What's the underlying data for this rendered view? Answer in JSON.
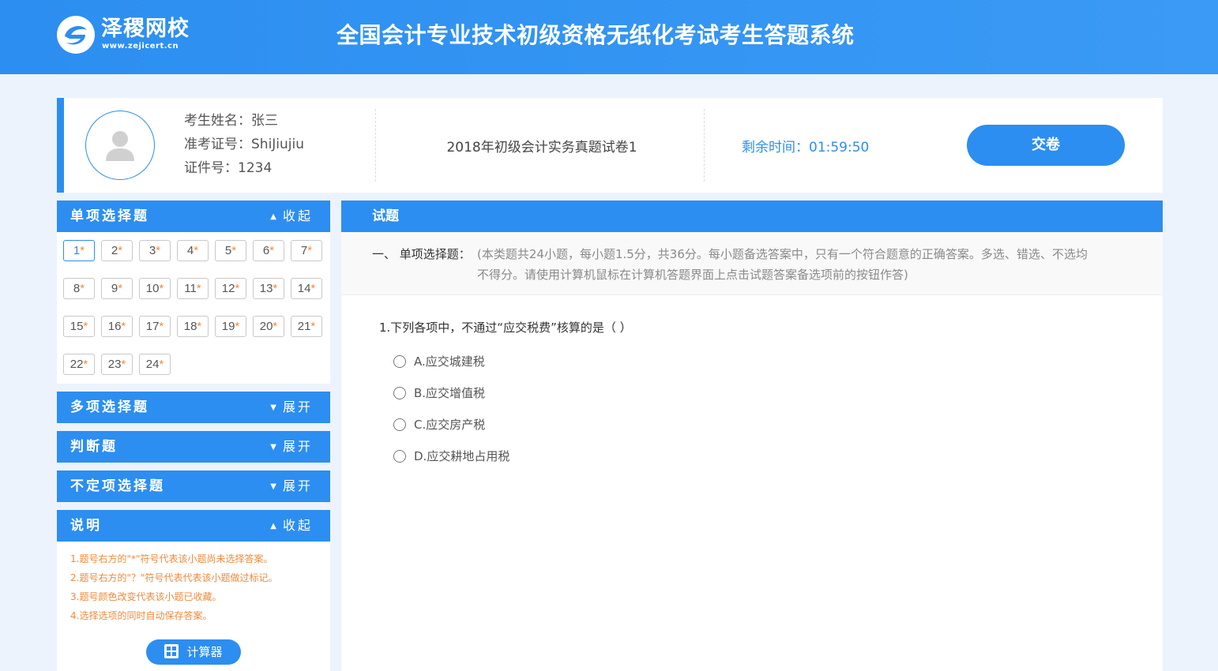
{
  "header": {
    "brand_name": "泽稷网校",
    "brand_url": "www.zejicert.cn",
    "title": "全国会计专业技术初级资格无纸化考试考生答题系统",
    "bg_color": "#2c8ef0"
  },
  "candidate": {
    "name_label": "考生姓名：",
    "name": "张三",
    "ticket_label": "准考证号：",
    "ticket": "ShiJiujiu",
    "id_label": "证件号：",
    "id": "1234"
  },
  "exam": {
    "paper_title": "2018年初级会计实务真题试卷1",
    "timer_label": "剩余时间：",
    "timer": "01:59:50",
    "submit_label": "交卷"
  },
  "sidebar": {
    "sections": [
      {
        "title": "单项选择题",
        "toggle": "收起",
        "arrow": "▲"
      },
      {
        "title": "多项选择题",
        "toggle": "展开",
        "arrow": "▼"
      },
      {
        "title": "判断题",
        "toggle": "展开",
        "arrow": "▼"
      },
      {
        "title": "不定项选择题",
        "toggle": "展开",
        "arrow": "▼"
      },
      {
        "title": "说明",
        "toggle": "收起",
        "arrow": "▲"
      }
    ],
    "questions": [
      "1",
      "2",
      "3",
      "4",
      "5",
      "6",
      "7",
      "8",
      "9",
      "10",
      "11",
      "12",
      "13",
      "14",
      "15",
      "16",
      "17",
      "18",
      "19",
      "20",
      "21",
      "22",
      "23",
      "24"
    ],
    "unanswered_mark": "*",
    "active_question": "1",
    "notes": [
      "1.题号右方的\"*\"符号代表该小题尚未选择答案。",
      "2.题号右方的\"？\"符号代表代表该小题做过标记。",
      "3.题号颜色改变代表该小题已收藏。",
      "4.选择选项的同时自动保存答案。"
    ],
    "calculator_label": "计算器"
  },
  "question_panel": {
    "header": "试题",
    "section_label": "一、 单项选择题：",
    "instructions_line1": "(本类题共24小题，每小题1.5分，共36分。每小题备选答案中，只有一个符合题意的正确答案。多选、错选、不选均",
    "instructions_line2": "不得分。请使用计算机鼠标在计算机答题界面上点击试题答案备选项前的按钮作答)",
    "stem": "1.下列各项中，不通过“应交税费”核算的是（ ）",
    "options": [
      "A.应交城建税",
      "B.应交增值税",
      "C.应交房产税",
      "D.应交耕地占用税"
    ]
  }
}
